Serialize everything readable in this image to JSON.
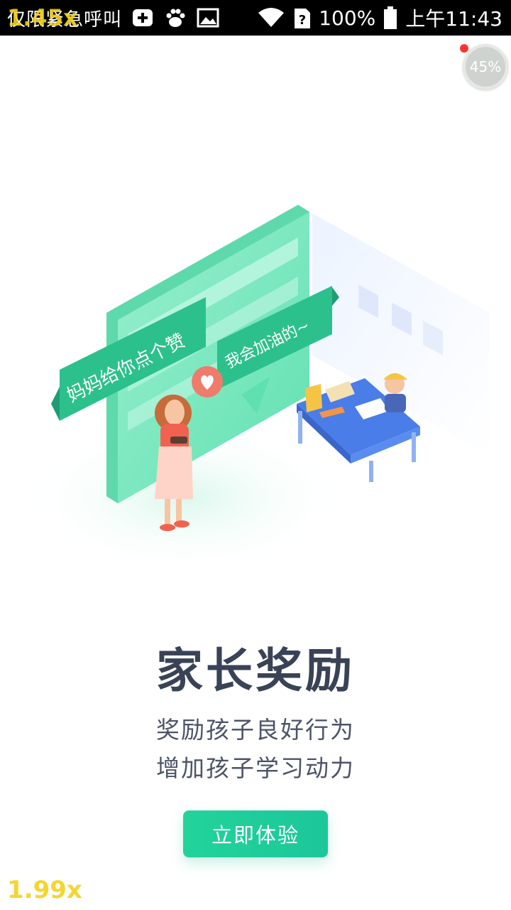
{
  "status_bar": {
    "left_text": "仅限紧急呼叫",
    "battery": "100%",
    "time": "上午11:43",
    "icons": [
      "add-icon",
      "baidu-paw-icon",
      "image-icon",
      "wifi-icon",
      "sim-unknown-icon",
      "battery-icon"
    ]
  },
  "overlay": {
    "badge": "45%",
    "speed_top": "1.45x",
    "speed_bottom": "1.99x"
  },
  "illustration": {
    "banner_left": "妈妈给你点个赞",
    "banner_right": "我会加油的~"
  },
  "main": {
    "title": "家长奖励",
    "subtitle_line1": "奖励孩子良好行为",
    "subtitle_line2": "增加孩子学习动力",
    "cta_label": "立即体验"
  },
  "colors": {
    "accent": "#1fd09a",
    "title": "#3a4356",
    "text": "#4b5468",
    "desk": "#4a7de8"
  }
}
